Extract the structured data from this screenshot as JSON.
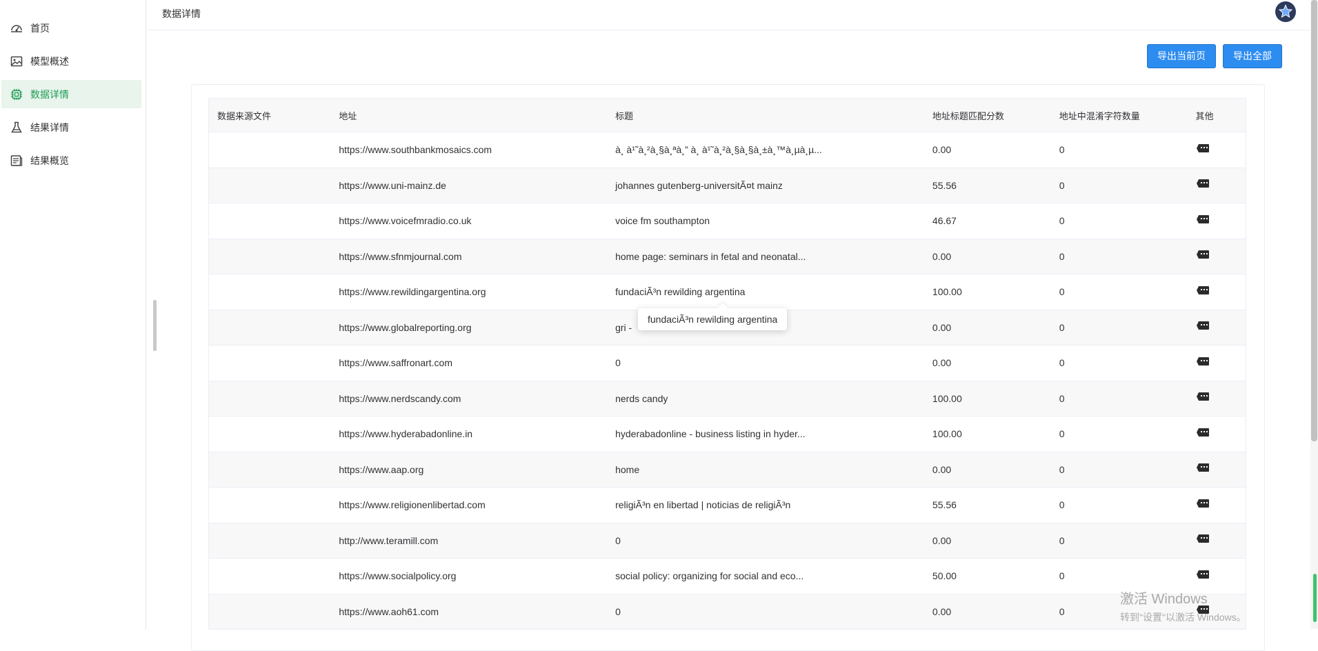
{
  "sidebar": {
    "items": [
      {
        "label": "首页",
        "icon": "dashboard-icon"
      },
      {
        "label": "模型概述",
        "icon": "image-icon"
      },
      {
        "label": "数据详情",
        "icon": "chip-icon"
      },
      {
        "label": "结果详情",
        "icon": "flask-icon"
      },
      {
        "label": "结果概览",
        "icon": "document-icon"
      }
    ],
    "active_index": 2,
    "active_color": "#1f9d55"
  },
  "header": {
    "title": "数据详情",
    "avatar_icon": "star-avatar-icon"
  },
  "toolbar": {
    "export_page_label": "导出当前页",
    "export_all_label": "导出全部",
    "button_color": "#2d8cf0"
  },
  "table": {
    "columns": [
      "数据来源文件",
      "地址",
      "标题",
      "地址标题匹配分数",
      "地址中混淆字符数量",
      "其他"
    ],
    "rows": [
      {
        "source": "",
        "url": "https://www.southbankmosaics.com",
        "title": "à¸ à¹˜à¸²à¸§à¸ªà¸” à¸ à¹˜à¸²à¸§à¸§à¸±à¸™à¸µà¸µ...",
        "score": "0.00",
        "confusables": "0"
      },
      {
        "source": "",
        "url": "https://www.uni-mainz.de",
        "title": "johannes gutenberg-universitÃ¤t mainz",
        "score": "55.56",
        "confusables": "0"
      },
      {
        "source": "",
        "url": "https://www.voicefmradio.co.uk",
        "title": "voice fm southampton",
        "score": "46.67",
        "confusables": "0"
      },
      {
        "source": "",
        "url": "https://www.sfnmjournal.com",
        "title": "home page: seminars in fetal and neonatal...",
        "score": "0.00",
        "confusables": "0"
      },
      {
        "source": "",
        "url": "https://www.rewildingargentina.org",
        "title": "fundaciÃ³n rewilding argentina",
        "score": "100.00",
        "confusables": "0"
      },
      {
        "source": "",
        "url": "https://www.globalreporting.org",
        "title": "gri -",
        "score": "0.00",
        "confusables": "0"
      },
      {
        "source": "",
        "url": "https://www.saffronart.com",
        "title": "0",
        "score": "0.00",
        "confusables": "0"
      },
      {
        "source": "",
        "url": "https://www.nerdscandy.com",
        "title": "nerds candy",
        "score": "100.00",
        "confusables": "0"
      },
      {
        "source": "",
        "url": "https://www.hyderabadonline.in",
        "title": "hyderabadonline - business listing in hyder...",
        "score": "100.00",
        "confusables": "0"
      },
      {
        "source": "",
        "url": "https://www.aap.org",
        "title": "home",
        "score": "0.00",
        "confusables": "0"
      },
      {
        "source": "",
        "url": "https://www.religionenlibertad.com",
        "title": "religiÃ³n en libertad | noticias de religiÃ³n",
        "score": "55.56",
        "confusables": "0"
      },
      {
        "source": "",
        "url": "http://www.teramill.com",
        "title": "0",
        "score": "0.00",
        "confusables": "0"
      },
      {
        "source": "",
        "url": "https://www.socialpolicy.org",
        "title": "social policy: organizing for social and eco...",
        "score": "50.00",
        "confusables": "0"
      },
      {
        "source": "",
        "url": "https://www.aoh61.com",
        "title": "0",
        "score": "0.00",
        "confusables": "0"
      }
    ],
    "action_icon": "message-icon"
  },
  "tooltip": {
    "text": "fundaciÃ³n rewilding argentina"
  },
  "watermark": {
    "line1": "激活 Windows",
    "line2": "转到\"设置\"以激活 Windows。"
  }
}
